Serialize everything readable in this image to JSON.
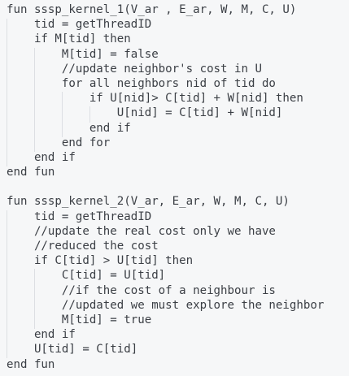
{
  "code": {
    "lines": [
      "fun sssp_kernel_1(V_ar , E_ar, W, M, C, U)",
      "    tid = getThreadID",
      "    if M[tid] then",
      "        M[tid] = false",
      "        //update neighbor's cost in U",
      "        for all neighbors nid of tid do",
      "            if U[nid]> C[tid] + W[nid] then",
      "                U[nid] = C[tid] + W[nid]",
      "            end if",
      "        end for",
      "    end if",
      "end fun",
      "",
      "fun sssp_kernel_2(V_ar, E_ar, W, M, C, U)",
      "    tid = getThreadID",
      "    //update the real cost only we have",
      "    //reduced the cost",
      "    if C[tid] > U[tid] then",
      "        C[tid] = U[tid]",
      "        //if the cost of a neighbour is",
      "        //updated we must explore the neighbor",
      "        M[tid] = true",
      "    end if",
      "    U[tid] = C[tid]",
      "end fun"
    ]
  }
}
